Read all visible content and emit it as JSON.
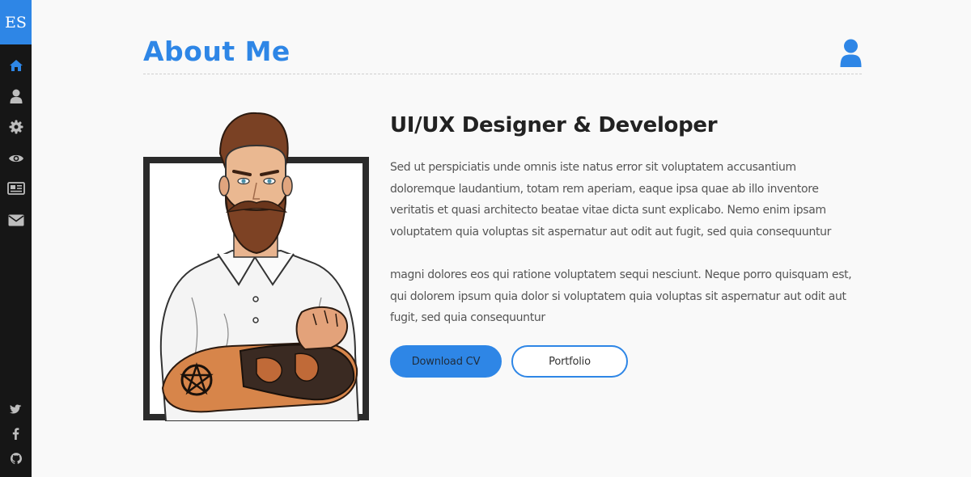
{
  "sidebar": {
    "logo": "ES",
    "nav": [
      "home-icon",
      "user-icon",
      "gear-icon",
      "eye-icon",
      "newspaper-icon",
      "envelope-icon"
    ],
    "social": [
      "twitter-icon",
      "facebook-icon",
      "github-icon"
    ]
  },
  "colors": {
    "accent": "#2e86e6",
    "sidebar": "#161616",
    "background": "#f9f9f9"
  },
  "header": {
    "title": "About Me",
    "icon": "user-icon"
  },
  "about": {
    "role": "UI/UX Designer & Developer",
    "paragraph1": "Sed ut perspiciatis unde omnis iste natus error sit voluptatem accusantium doloremque laudantium, totam rem aperiam, eaque ipsa quae ab illo inventore veritatis et quasi architecto beatae vitae dicta sunt explicabo. Nemo enim ipsam voluptatem quia voluptas sit aspernatur aut odit aut fugit, sed quia consequuntur",
    "paragraph2": "magni dolores eos qui ratione voluptatem sequi nesciunt. Neque porro quisquam est, qui dolorem ipsum quia dolor si voluptatem quia voluptas sit aspernatur aut odit aut fugit, sed quia consequuntur",
    "download_label": "Download CV",
    "portfolio_label": "Portfolio"
  }
}
